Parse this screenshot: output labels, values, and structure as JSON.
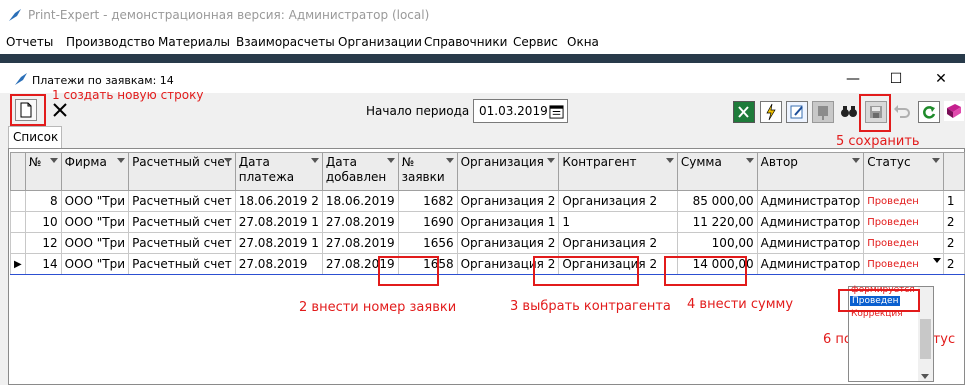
{
  "app": {
    "title": "Print-Expert - демонстрационная версия: Администратор (local)",
    "menu": [
      "Отчеты",
      "Производство",
      "Материалы",
      "Взаиморасчеты",
      "Организации",
      "Справочники",
      "Сервис",
      "Окна"
    ]
  },
  "window": {
    "title": "Платежи по заявкам: 14",
    "minimize": "—",
    "maximize": "☐",
    "close": "✕"
  },
  "toolbar": {
    "period_label": "Начало периода",
    "period_value": "01.03.2019"
  },
  "tabs": [
    "Список"
  ],
  "grid": {
    "columns": [
      "№",
      "Фирма",
      "Расчетный счет",
      "Дата платежа",
      "Дата добавлен",
      "№ заявки",
      "Организация",
      "Контрагент",
      "Сумма",
      "Автор",
      "Статус",
      ""
    ],
    "rows": [
      {
        "marker": "",
        "num": "8",
        "firm": "ООО \"Три",
        "account": "Расчетный счет",
        "pay_date": "18.06.2019 2",
        "added": "18.06.2019",
        "order": "1682",
        "org": "Организация 2",
        "contractor": "Организация 2",
        "sum": "85 000,00",
        "author": "Администратор",
        "status": "Проведен",
        "extra": "1"
      },
      {
        "marker": "",
        "num": "10",
        "firm": "ООО \"Три",
        "account": "Расчетный счет",
        "pay_date": "27.08.2019 1",
        "added": "27.08.2019",
        "order": "1690",
        "org": "Организация 1",
        "contractor": "1",
        "sum": "11 220,00",
        "author": "Администратор",
        "status": "Проведен",
        "extra": "2"
      },
      {
        "marker": "",
        "num": "12",
        "firm": "ООО \"Три",
        "account": "Расчетный счет",
        "pay_date": "27.08.2019 1",
        "added": "27.08.2019",
        "order": "1656",
        "org": "Организация 2",
        "contractor": "Организация 2",
        "sum": "100,00",
        "author": "Администратор",
        "status": "Проведен",
        "extra": "2"
      },
      {
        "marker": "▶",
        "num": "14",
        "firm": "ООО \"Три",
        "account": "Расчетный счет",
        "pay_date": "27.08.2019",
        "added": "27.08.2019",
        "order": "1658",
        "org": "Организация 2",
        "contractor": "Организация 2",
        "sum": "14 000,00",
        "author": "Администратор",
        "status": "Проведен",
        "extra": "2"
      }
    ]
  },
  "status_dropdown": {
    "options": [
      "формируется",
      "Проведен",
      "Коррекция"
    ],
    "selected": "Проведен"
  },
  "annotations": {
    "a1": "1 создать новую строку",
    "a2": "2 внести номер заявки",
    "a3": "3 выбрать контрагента",
    "a4": "4 внести сумму",
    "a5": "5 сохранить",
    "a6": "6 поставить статус"
  },
  "colors": {
    "annotation": "#e21b1b",
    "status_text": "#e21b1b",
    "selection": "#0a5fcf",
    "dark_strip": "#283a4a"
  }
}
